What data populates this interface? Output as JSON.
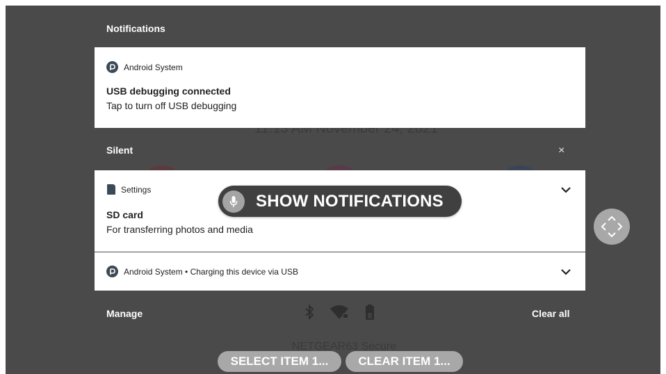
{
  "background": {
    "clock_text": "11:13 AM November 24, 2021",
    "network_name": "NETGEAR63 Secure"
  },
  "header": {
    "title": "Notifications"
  },
  "usb_debug_card": {
    "app_name": "Android System",
    "title": "USB debugging connected",
    "text": "Tap to turn off USB debugging"
  },
  "silent_section": {
    "title": "Silent",
    "dismiss_label": "×"
  },
  "sd_card": {
    "app_name": "Settings",
    "title": "SD card",
    "text": "For transferring photos and media"
  },
  "charging_card": {
    "summary": "Android System • Charging this device via USB"
  },
  "footer": {
    "manage_label": "Manage",
    "clear_all_label": "Clear all"
  },
  "voice_overlay": {
    "command": "SHOW NOTIFICATIONS"
  },
  "bottom_actions": {
    "select_label": "SELECT ITEM 1...",
    "clear_label": "CLEAR ITEM 1..."
  },
  "colors": {
    "shade": "#4a4a4a",
    "card": "#ffffff",
    "icon": "#3c4a57",
    "overlay_button": "#a8a8a8"
  },
  "icons": [
    "android-system-icon",
    "sd-card-icon",
    "chevron-down-icon",
    "close-icon",
    "mic-icon",
    "dpad-icon",
    "bluetooth-icon",
    "wifi-locked-icon",
    "battery-icon"
  ]
}
